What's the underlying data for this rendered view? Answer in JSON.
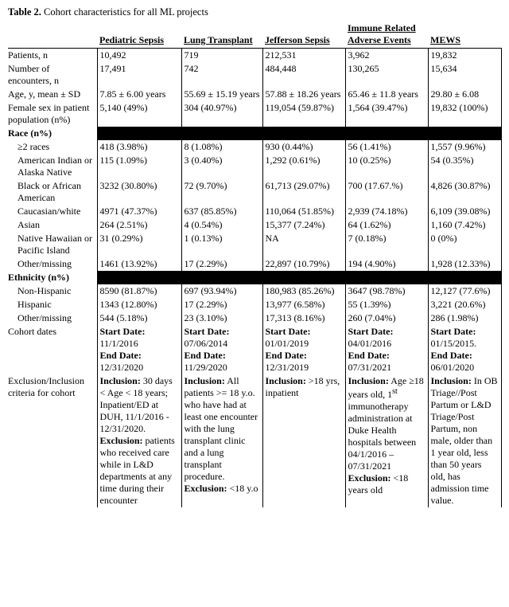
{
  "caption_label": "Table 2.",
  "caption_text": "Cohort characteristics for all ML projects",
  "columns": [
    "Pediatric Sepsis",
    "Lung Transplant",
    "Jefferson Sepsis",
    "Immune Related Adverse Events",
    "MEWS"
  ],
  "rows": {
    "patients": {
      "label": "Patients, n",
      "v": [
        "10,492",
        "719",
        "212,531",
        "3,962",
        "19,832"
      ]
    },
    "encounters": {
      "label": "Number of encounters, n",
      "v": [
        "17,491",
        "742",
        "484,448",
        "130,265",
        "15,634"
      ]
    },
    "age": {
      "label": "Age, y, mean ± SD",
      "v": [
        "7.85  ±  6.00 years",
        "55.69 ± 15.19 years",
        "57.88 ± 18.26 years",
        "65.46  ±  11.8 years",
        "29.80 ± 6.08"
      ]
    },
    "female": {
      "label": "Female sex in patient population (n%)",
      "v": [
        "5,140 (49%)",
        "304 (40.97%)",
        "119,054 (59.87%)",
        "1,564 (39.47%)",
        "19,832 (100%)"
      ]
    },
    "race_header": {
      "label": "Race (n%)"
    },
    "race_2plus": {
      "label": "≥2 races",
      "v": [
        "418 (3.98%)",
        "8 (1.08%)",
        "930 (0.44%)",
        " 56 (1.41%)",
        "1,557 (9.96%)"
      ]
    },
    "race_aian": {
      "label": "American Indian or Alaska Native",
      "v": [
        "115 (1.09%)",
        "3 (0.40%)",
        "1,292 (0.61%)",
        "10 (0.25%)",
        "54 (0.35%)"
      ]
    },
    "race_black": {
      "label": "Black or African American",
      "v": [
        "3232 (30.80%)",
        "72 (9.70%)",
        "61,713 (29.07%)",
        "700 (17.67.%)",
        "4,826 (30.87%)"
      ]
    },
    "race_white": {
      "label": "Caucasian/white",
      "v": [
        "4971 (47.37%)",
        "637 (85.85%)",
        "110,064 (51.85%)",
        "2,939 (74.18%)",
        "6,109 (39.08%)"
      ]
    },
    "race_asian": {
      "label": "Asian",
      "v": [
        "264 (2.51%)",
        "4 (0.54%)",
        "15,377 (7.24%)",
        "64 (1.62%)",
        "1,160 (7.42%)"
      ]
    },
    "race_nhpi": {
      "label": "Native Hawaiian or Pacific Island",
      "v": [
        "31 (0.29%)",
        "1 (0.13%)",
        "NA",
        "7 (0.18%)",
        "0 (0%)"
      ]
    },
    "race_other": {
      "label": "Other/missing",
      "v": [
        "1461 (13.92%)",
        "17 (2.29%)",
        "22,897 (10.79%)",
        "194 (4.90%)",
        "1,928 (12.33%)"
      ]
    },
    "eth_header": {
      "label": "Ethnicity (n%)"
    },
    "eth_nonhisp": {
      "label": "Non-Hispanic",
      "v": [
        "8590 (81.87%)",
        "697 (93.94%)",
        "180,983 (85.26%)",
        "3647 (98.78%)",
        "12,127 (77.6%)"
      ]
    },
    "eth_hisp": {
      "label": "Hispanic",
      "v": [
        "1343 (12.80%)",
        "17 (2.29%)",
        "13,977 (6.58%)",
        "55 (1.39%)",
        "3,221 (20.6%)"
      ]
    },
    "eth_other": {
      "label": "Other/missing",
      "v": [
        "544 (5.18%)",
        "23 (3.10%)",
        "17,313 (8.16%)",
        "260 (7.04%)",
        "286 (1.98%)"
      ]
    },
    "dates": {
      "label": "Cohort dates",
      "v_html": [
        "<b>Start Date:</b> 11/1/2016<br><b>End Date:</b> 12/31/2020",
        "<b>Start Date:</b> 07/06/2014<br><b>End Date:</b> 11/29/2020",
        "<b>Start Date:</b> 01/01/2019<br><b>End Date:</b> 12/31/2019",
        "<b>Start Date:</b> 04/01/2016<br><b>End Date:</b> 07/31/2021",
        "<b>Start Date:</b> 01/15/2015.<br><b>End Date:</b> 06/01/2020"
      ]
    },
    "criteria": {
      "label": "Exclusion/Inclusion criteria for cohort",
      "v_html": [
        "<b>Inclusion:</b> 30 days &lt; Age &lt; 18 years; Inpatient/ED at DUH, 11/1/2016 - 12/31/2020. <b>Exclusion:</b> patients who received care while in L&amp;D departments at any time during their encounter",
        "<b>Inclusion:</b> All patients &gt;= 18 y.o. who have had at least one encounter with the lung transplant clinic and a lung transplant procedure. <b>Exclusion:</b> &lt;18 y.o",
        "<b>Inclusion:</b> &gt;18 yrs, inpatient",
        "<b>Inclusion:</b> Age ≥18 years old, 1<sup>st</sup> immunotherapy administration at Duke Health hospitals between 04/1/2016 – 07/31/2021 <b>Exclusion:</b> &lt;18 years old",
        "<b>Inclusion:</b> In OB Triage//Post Partum or L&amp;D Triage/Post Partum, non male, older than 1 year old, less than 50 years old, has admission time value."
      ]
    }
  }
}
